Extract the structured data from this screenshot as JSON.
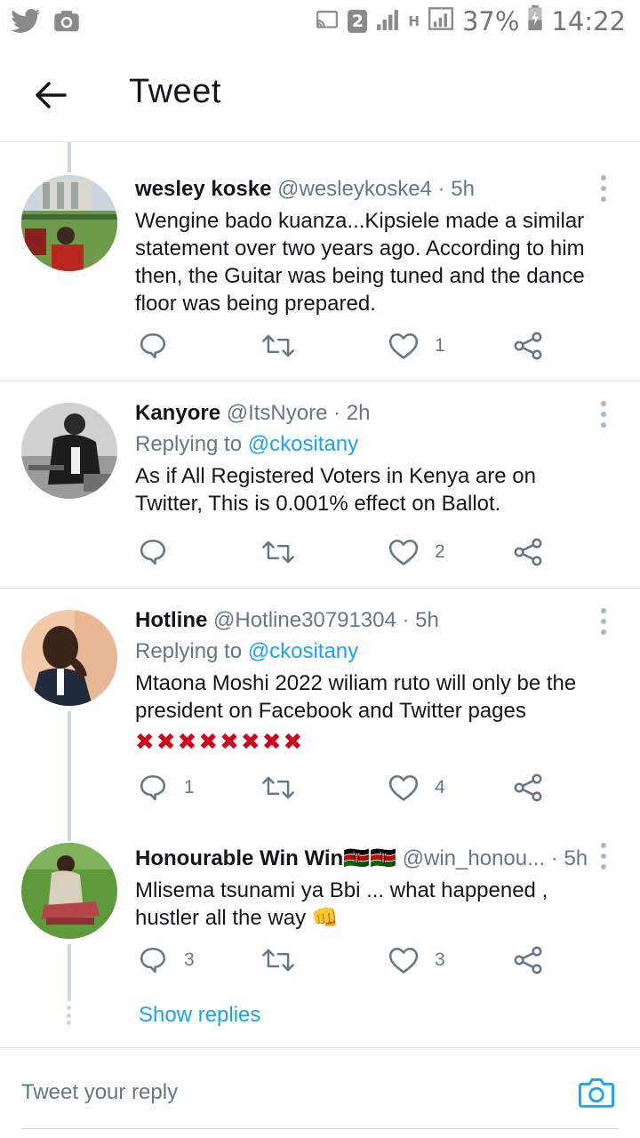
{
  "status_bar": {
    "left_icons": [
      "twitter-bird-icon",
      "camera-icon"
    ],
    "sim_badge": "2",
    "network_h": "H",
    "battery_percent": "37%",
    "time": "14:22"
  },
  "header": {
    "back_icon": "arrow-left-icon",
    "title": "Tweet"
  },
  "tweets": [
    {
      "name": "wesley koske",
      "handle": "@wesleykoske4 · 5h",
      "replying_label": "",
      "replying_to": "",
      "text": "Wengine bado kuanza...Kipsiele made a similar statement over two years ago. According to him then, the Guitar was being tuned and the dance floor was being prepared.",
      "reply_count": "",
      "retweet_count": "",
      "like_count": "1"
    },
    {
      "name": "Kanyore",
      "handle": "@ItsNyore · 2h",
      "replying_label": "Replying to",
      "replying_to": "@ckositany",
      "text": "As if All Registered Voters in Kenya are on Twitter, This is 0.001% effect on Ballot.",
      "reply_count": "",
      "retweet_count": "",
      "like_count": "2"
    },
    {
      "name": "Hotline",
      "handle": "@Hotline30791304 · 5h",
      "replying_label": "Replying to",
      "replying_to": "@ckositany",
      "text": "Mtaona Moshi 2022 wiliam ruto will only be the president on Facebook and Twitter pages",
      "extra": "✖✖✖✖✖✖✖✖",
      "reply_count": "1",
      "retweet_count": "",
      "like_count": "4"
    },
    {
      "name": "Honourable Win Win",
      "name_flags": "🇰🇪🇰🇪",
      "handle": "@win_honou... · 5h",
      "text": "Mlisema tsunami ya Bbi ... what happened , hustler all the way 👊",
      "reply_count": "3",
      "retweet_count": "",
      "like_count": "3"
    }
  ],
  "show_replies": "Show replies",
  "composer": {
    "placeholder": "Tweet your reply",
    "camera_icon": "camera-icon"
  },
  "colors": {
    "accent": "#1da1f2",
    "text_primary": "#14171a",
    "text_secondary": "#657786",
    "divider": "#e1e8ed"
  }
}
